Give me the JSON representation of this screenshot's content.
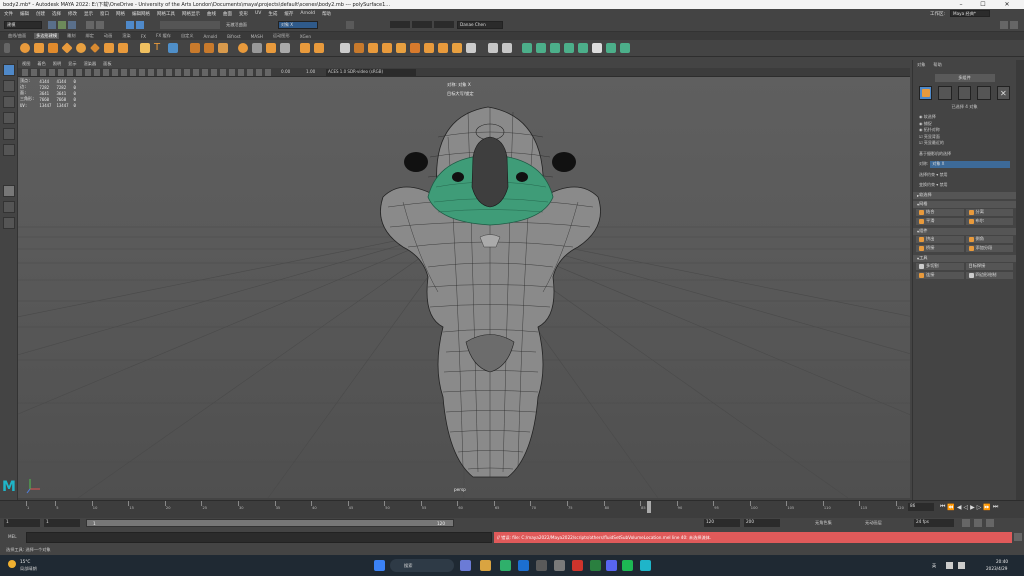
{
  "titlebar": {
    "title": "body2.mb* - Autodesk MAYA 2022: E:\\下载\\OneDrive - University of the Arts London\\Documents\\maya\\projects\\default\\scenes\\body2.mb  ---  polySurface1..."
  },
  "menu": [
    "文件",
    "编辑",
    "创建",
    "选择",
    "修改",
    "显示",
    "窗口",
    "网格",
    "编辑网格",
    "网格工具",
    "网格显示",
    "曲线",
    "曲面",
    "变形",
    "UV",
    "生成",
    "缓存",
    "Arnold",
    "帮助"
  ],
  "status": {
    "mode": "建模",
    "object_field": "对象 X",
    "user": "Danae Chen",
    "workspace_label": "工作区:",
    "workspace": "Maya 经典*",
    "no_live": "无激活曲面"
  },
  "shelf_tabs": [
    "曲线/曲面",
    "多边形建模",
    "雕刻",
    "绑定",
    "动画",
    "渲染",
    "FX",
    "FX 缓存",
    "自定义",
    "Arnold",
    "Bifrost",
    "MASH",
    "运动图形",
    "XGen"
  ],
  "active_shelf_tab": "多边形建模",
  "panel_menu": [
    "视图",
    "着色",
    "照明",
    "显示",
    "渲染器",
    "面板"
  ],
  "panel_toolbar": {
    "value1": "0.00",
    "value2": "1.00",
    "colorspace": "ACES 1.0 SDR-video (sRGB)"
  },
  "hud": {
    "rows": [
      {
        "label": "顶点:",
        "a": "4144",
        "b": "4144",
        "c": "0"
      },
      {
        "label": "边:",
        "a": "7282",
        "b": "7282",
        "c": "0"
      },
      {
        "label": "面:",
        "a": "3641",
        "b": "3641",
        "c": "0"
      },
      {
        "label": "三角形:",
        "a": "7660",
        "b": "7660",
        "c": "0"
      },
      {
        "label": "UV:",
        "a": "13447",
        "b": "13447",
        "c": "0"
      }
    ],
    "center_top": "对称: 对象 X",
    "center_sub": "目标大写/锁定",
    "camera": "persp"
  },
  "right_panel": {
    "tabs": [
      "对象",
      "帮助"
    ],
    "multi_btn": "多组件",
    "selected": "已选择 4 对象",
    "options": [
      "软选择",
      "捕捉",
      "拓扑对称",
      "亮显背面",
      "亮显最近的"
    ],
    "symmetry_label": "对称:",
    "symmetry_value": "对象 X",
    "sel_a": "选择约束",
    "sel_b": "变换约束",
    "sel_a_val": "禁用",
    "sel_b_val": "禁用",
    "step": "基于摄影机的选择",
    "sections": [
      {
        "title": "软选择",
        "buttons": []
      },
      {
        "title": "网格",
        "buttons": [
          "结合",
          "分离",
          "平滑",
          "布尔"
        ]
      },
      {
        "title": "组件",
        "buttons": [
          "挤出",
          "倒角",
          "桥接",
          "添加分段"
        ]
      },
      {
        "title": "工具",
        "buttons": [
          "多切割",
          "目标焊接",
          "连接",
          "四边形绘制"
        ]
      }
    ]
  },
  "timeline": {
    "ticks": [
      "1",
      "5",
      "10",
      "15",
      "20",
      "25",
      "30",
      "35",
      "40",
      "45",
      "50",
      "55",
      "60",
      "65",
      "70",
      "75",
      "80",
      "85",
      "90",
      "95",
      "100",
      "105",
      "110",
      "115",
      "120"
    ],
    "current_frame": "86",
    "playhead_value": 86,
    "range_start": "1",
    "range_start2": "1",
    "range_marker": "1",
    "range_end_marker": "120",
    "range_end": "120",
    "anim_end": "200",
    "character": "无角色集",
    "no_anim_layer": "无动画层",
    "fps": "24 fps"
  },
  "cmdline": {
    "label": "MEL",
    "error": "// 错误: file: C:/maya2022/Maya2022/scripts/others/fluidSetSubVolumeLocation.mel line 40: 未选择流体."
  },
  "helpline": "选择工具: 选择一个对象",
  "taskbar": {
    "weather_temp": "15°C",
    "weather_desc": "局部晴朗",
    "search": "搜索",
    "ime": "英",
    "time": "20:40",
    "date": "2023/4/29"
  }
}
